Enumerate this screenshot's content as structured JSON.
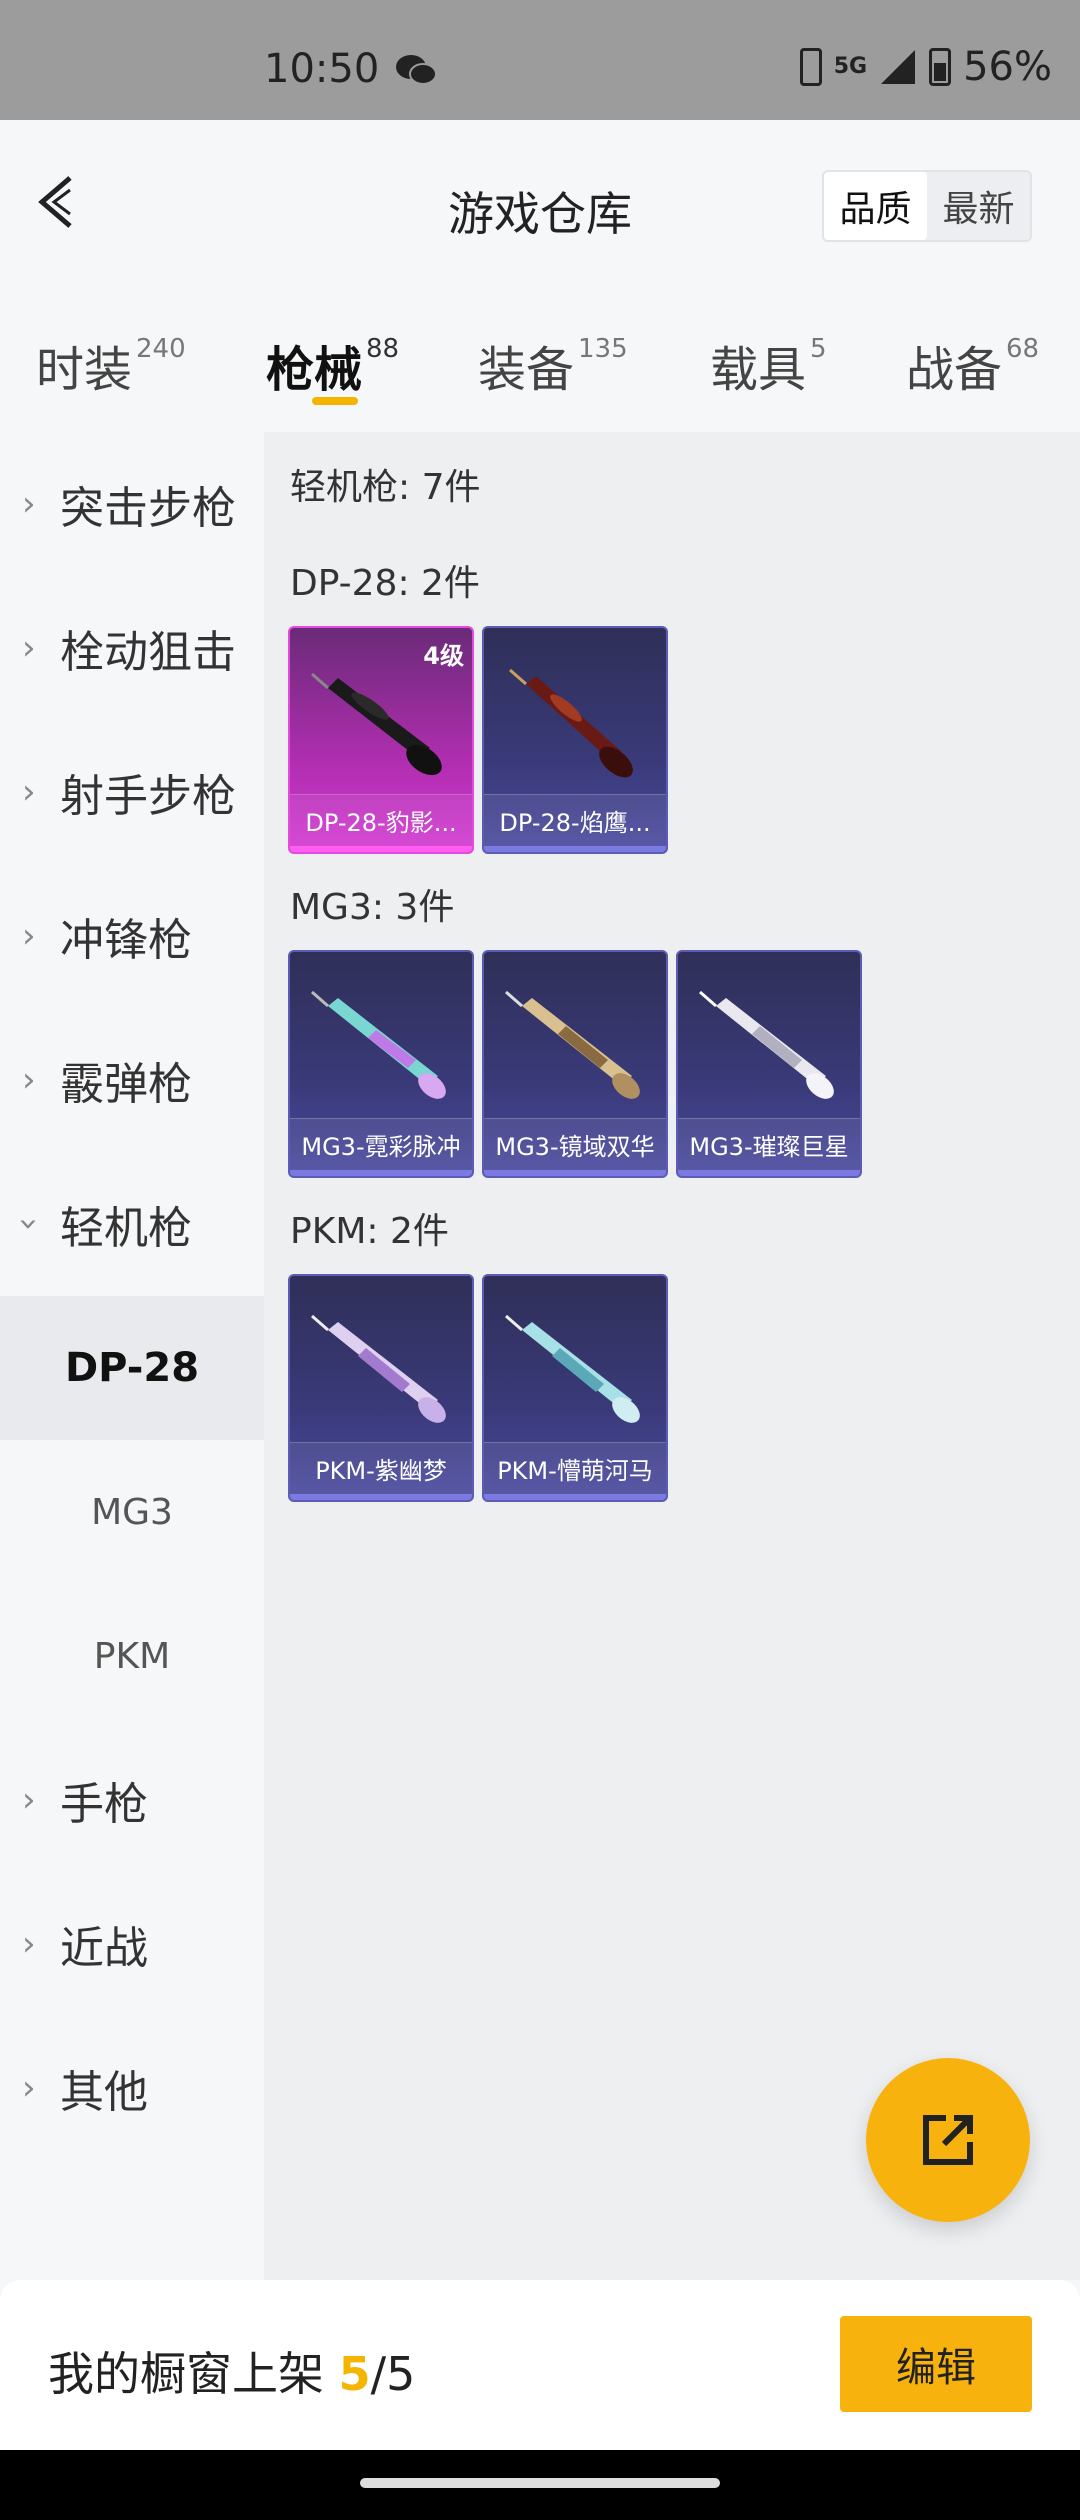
{
  "status_bar": {
    "time": "10:50",
    "network": "5G",
    "battery": "56%"
  },
  "header": {
    "title": "游戏仓库",
    "sort": [
      "品质",
      "最新"
    ]
  },
  "tabs": [
    {
      "label": "时装",
      "count": "240"
    },
    {
      "label": "枪械",
      "count": "88"
    },
    {
      "label": "装备",
      "count": "135"
    },
    {
      "label": "载具",
      "count": "5"
    },
    {
      "label": "战备",
      "count": "68"
    }
  ],
  "sidebar": {
    "categories": [
      "突击步枪",
      "栓动狙击",
      "射手步枪",
      "冲锋枪",
      "霰弹枪",
      "轻机枪",
      "手枪",
      "近战",
      "其他"
    ],
    "subitems": [
      "DP-28",
      "MG3",
      "PKM"
    ]
  },
  "content": {
    "summary": "轻机枪: 7件",
    "groups": [
      {
        "title": "DP-28: 2件",
        "items": [
          {
            "name": "DP-28-豹影...",
            "level": "4级"
          },
          {
            "name": "DP-28-焰鹰..."
          }
        ]
      },
      {
        "title": "MG3: 3件",
        "items": [
          {
            "name": "MG3-霓彩脉冲"
          },
          {
            "name": "MG3-镜域双华"
          },
          {
            "name": "MG3-璀璨巨星"
          }
        ]
      },
      {
        "title": "PKM: 2件",
        "items": [
          {
            "name": "PKM-紫幽梦"
          },
          {
            "name": "PKM-懵萌河马"
          }
        ]
      }
    ]
  },
  "bottom": {
    "label": "我的橱窗上架",
    "current": "5",
    "sep": "/",
    "total": "5",
    "edit": "编辑"
  },
  "colors": {
    "accent": "#f8b20e",
    "card": "#3a3a7a",
    "card_pink": "#b02eb0"
  }
}
